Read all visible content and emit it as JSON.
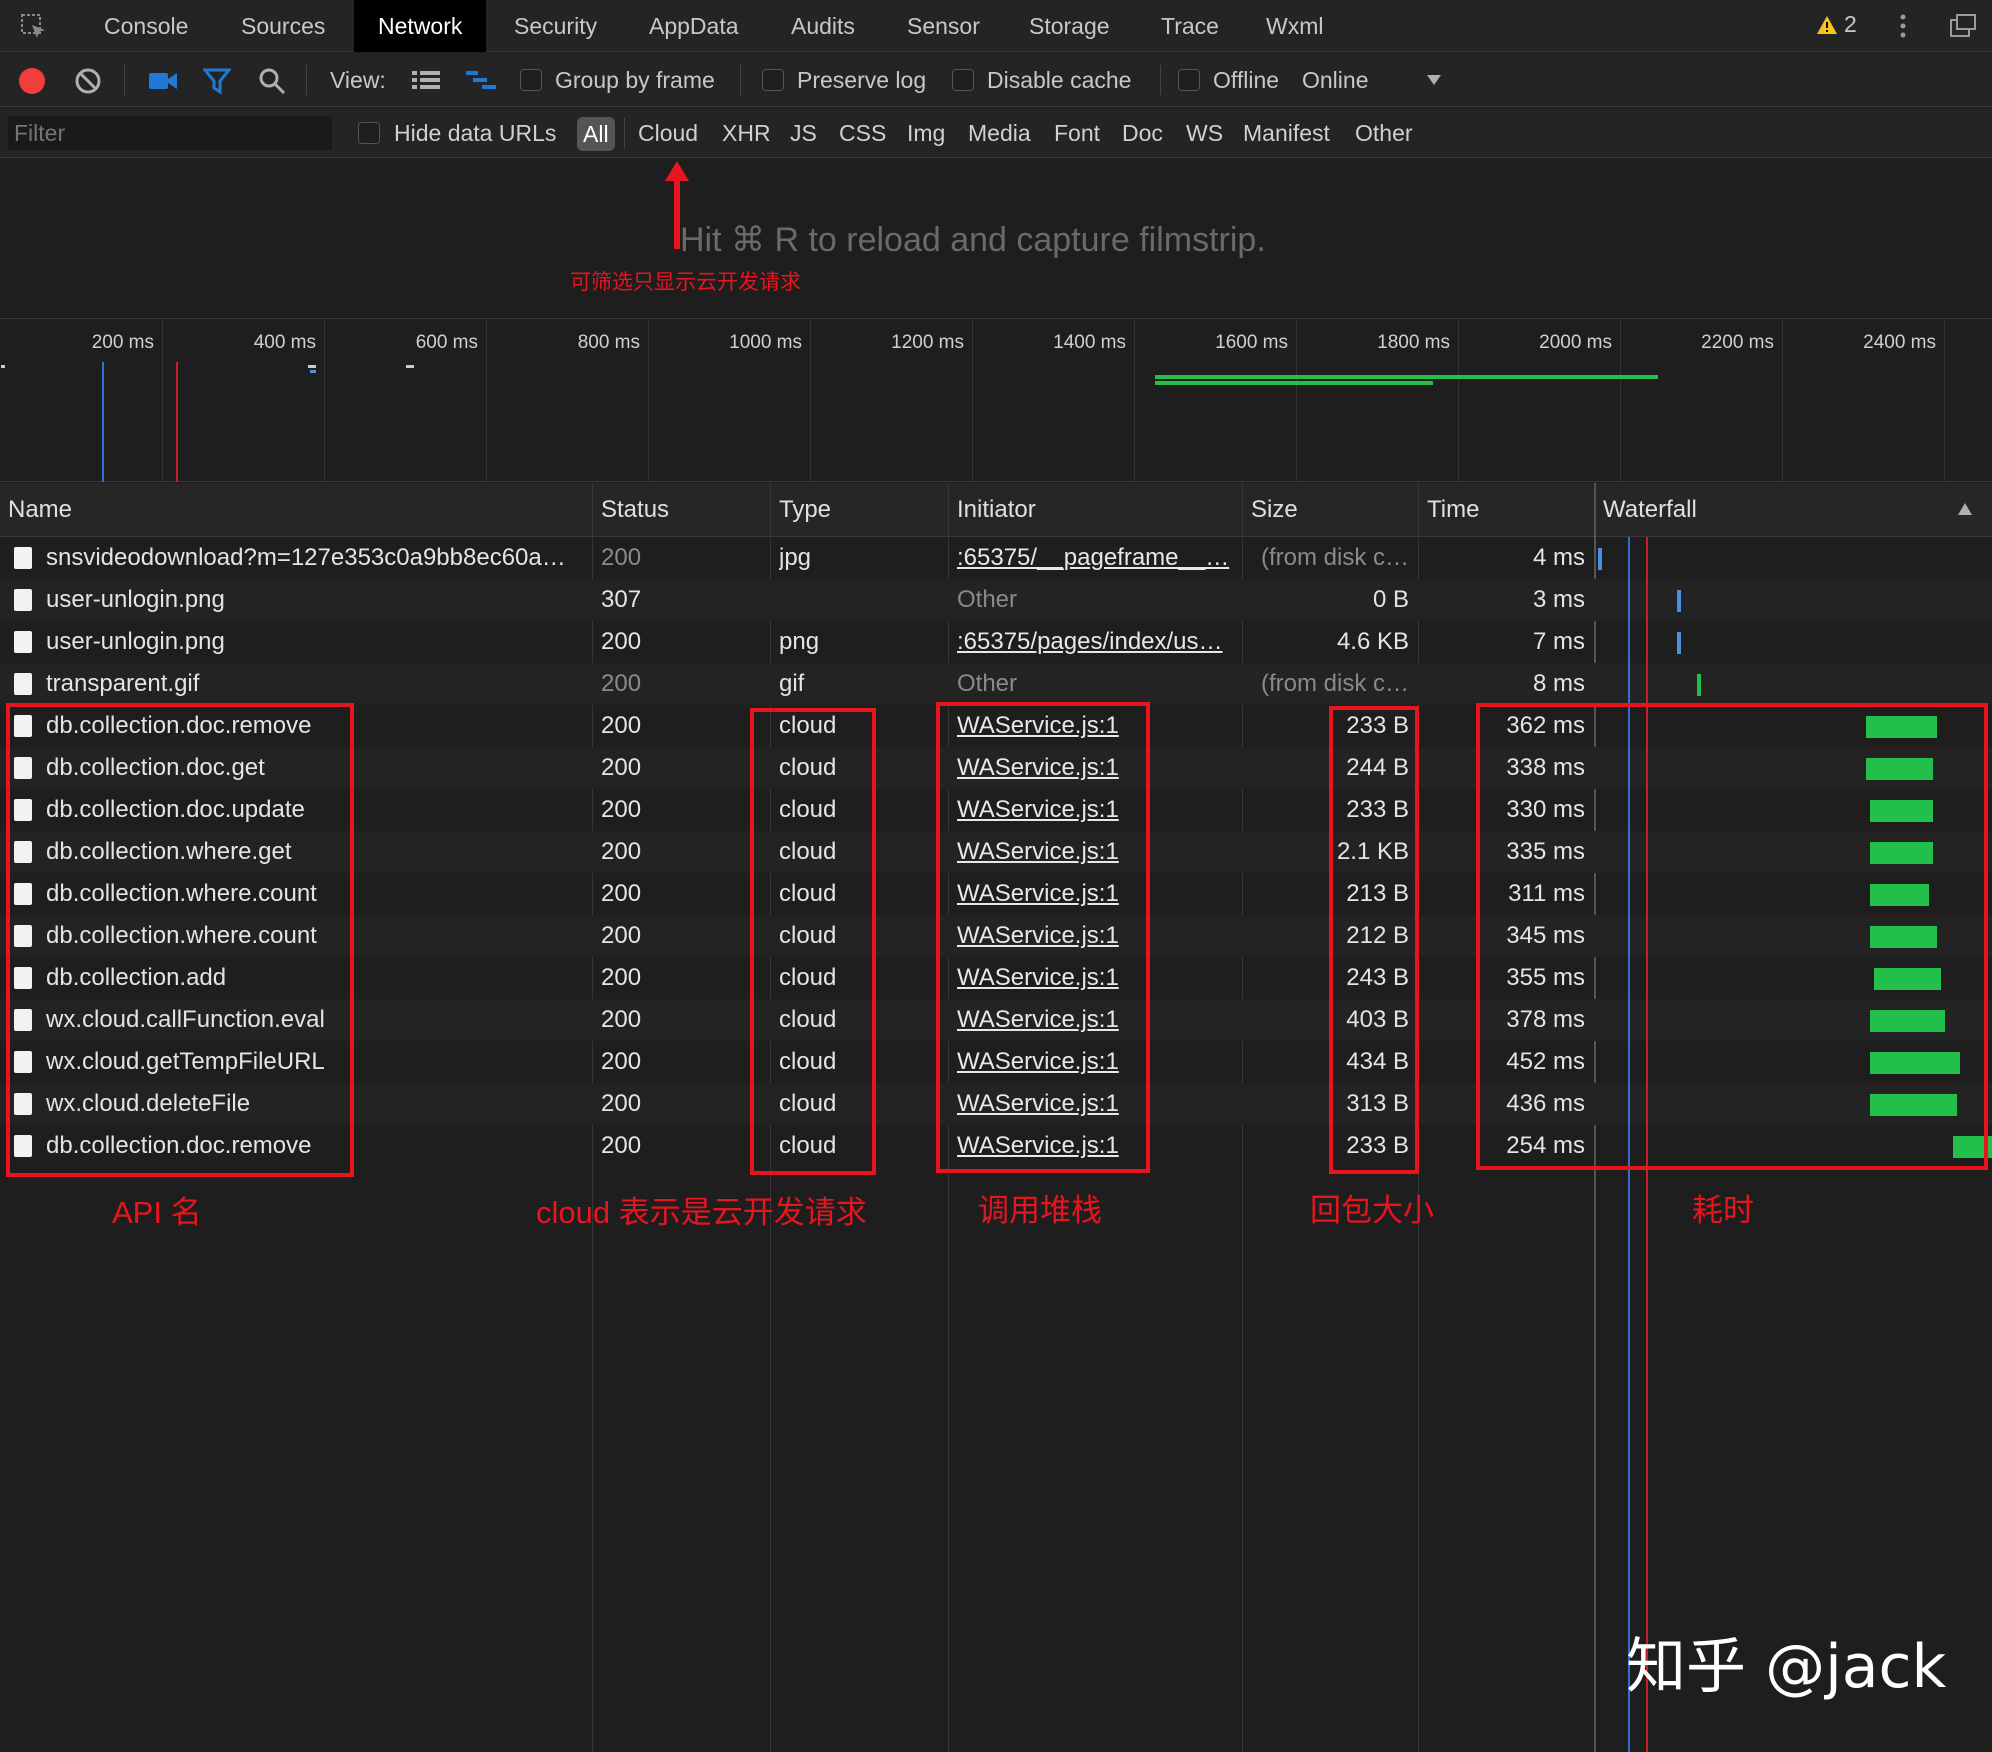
{
  "tabs": [
    {
      "label": "Console"
    },
    {
      "label": "Sources"
    },
    {
      "label": "Network"
    },
    {
      "label": "Security"
    },
    {
      "label": "AppData"
    },
    {
      "label": "Audits"
    },
    {
      "label": "Sensor"
    },
    {
      "label": "Storage"
    },
    {
      "label": "Trace"
    },
    {
      "label": "Wxml"
    }
  ],
  "warnings_count": "2",
  "toolbar": {
    "view_label": "View:",
    "group_by_frame": "Group by frame",
    "preserve_log": "Preserve log",
    "disable_cache": "Disable cache",
    "offline": "Offline",
    "throttle": "Online"
  },
  "filter": {
    "placeholder": "Filter",
    "hide_data_urls": "Hide data URLs",
    "types": [
      "All",
      "Cloud",
      "XHR",
      "JS",
      "CSS",
      "Img",
      "Media",
      "Font",
      "Doc",
      "WS",
      "Manifest",
      "Other"
    ]
  },
  "filmstrip_hint": "Hit ⌘ R to reload and capture filmstrip.",
  "annotations": {
    "cloud_filter": "可筛选只显示云开发请求",
    "api_name": "API 名",
    "cloud_type": "cloud 表示是云开发请求",
    "call_stack": "调用堆栈",
    "response_size": "回包大小",
    "time_cost": "耗时"
  },
  "overview_ticks": [
    "200 ms",
    "400 ms",
    "600 ms",
    "800 ms",
    "1000 ms",
    "1200 ms",
    "1400 ms",
    "1600 ms",
    "1800 ms",
    "2000 ms",
    "2200 ms",
    "2400 ms"
  ],
  "columns": [
    "Name",
    "Status",
    "Type",
    "Initiator",
    "Size",
    "Time",
    "Waterfall"
  ],
  "rows": [
    {
      "name": "snsvideodownload?m=127e353c0a9bb8ec60a…",
      "status": "200",
      "type": "jpg",
      "initiator": ":65375/__pageframe__…",
      "size": "(from disk c…",
      "time": "4 ms",
      "status_dim": true,
      "initiator_link": true,
      "size_dim": true,
      "wf_start": 0.0,
      "wf_len": 0.01,
      "wf_color": "#4a90e2"
    },
    {
      "name": "user-unlogin.png",
      "status": "307",
      "type": "",
      "initiator": "Other",
      "size": "0 B",
      "time": "3 ms",
      "status_dim": false,
      "initiator_link": false,
      "size_dim": false,
      "wf_start": 0.2,
      "wf_len": 0.01,
      "wf_color": "#4a90e2"
    },
    {
      "name": "user-unlogin.png",
      "status": "200",
      "type": "png",
      "initiator": ":65375/pages/index/us…",
      "size": "4.6 KB",
      "time": "7 ms",
      "status_dim": false,
      "initiator_link": true,
      "size_dim": false,
      "wf_start": 0.2,
      "wf_len": 0.01,
      "wf_color": "#4a90e2"
    },
    {
      "name": "transparent.gif",
      "status": "200",
      "type": "gif",
      "initiator": "Other",
      "size": "(from disk c…",
      "time": "8 ms",
      "status_dim": true,
      "initiator_link": false,
      "size_dim": true,
      "wf_start": 0.25,
      "wf_len": 0.01,
      "wf_color": "#22c04a"
    },
    {
      "name": "db.collection.doc.remove",
      "status": "200",
      "type": "cloud",
      "initiator": "WAService.js:1",
      "size": "233 B",
      "time": "362 ms",
      "status_dim": false,
      "initiator_link": true,
      "size_dim": false,
      "wf_start": 0.68,
      "wf_len": 0.18,
      "wf_color": "#22c04a"
    },
    {
      "name": "db.collection.doc.get",
      "status": "200",
      "type": "cloud",
      "initiator": "WAService.js:1",
      "size": "244 B",
      "time": "338 ms",
      "status_dim": false,
      "initiator_link": true,
      "size_dim": false,
      "wf_start": 0.68,
      "wf_len": 0.17,
      "wf_color": "#22c04a"
    },
    {
      "name": "db.collection.doc.update",
      "status": "200",
      "type": "cloud",
      "initiator": "WAService.js:1",
      "size": "233 B",
      "time": "330 ms",
      "status_dim": false,
      "initiator_link": true,
      "size_dim": false,
      "wf_start": 0.69,
      "wf_len": 0.16,
      "wf_color": "#22c04a"
    },
    {
      "name": "db.collection.where.get",
      "status": "200",
      "type": "cloud",
      "initiator": "WAService.js:1",
      "size": "2.1 KB",
      "time": "335 ms",
      "status_dim": false,
      "initiator_link": true,
      "size_dim": false,
      "wf_start": 0.69,
      "wf_len": 0.16,
      "wf_color": "#22c04a"
    },
    {
      "name": "db.collection.where.count",
      "status": "200",
      "type": "cloud",
      "initiator": "WAService.js:1",
      "size": "213 B",
      "time": "311 ms",
      "status_dim": false,
      "initiator_link": true,
      "size_dim": false,
      "wf_start": 0.69,
      "wf_len": 0.15,
      "wf_color": "#22c04a"
    },
    {
      "name": "db.collection.where.count",
      "status": "200",
      "type": "cloud",
      "initiator": "WAService.js:1",
      "size": "212 B",
      "time": "345 ms",
      "status_dim": false,
      "initiator_link": true,
      "size_dim": false,
      "wf_start": 0.69,
      "wf_len": 0.17,
      "wf_color": "#22c04a"
    },
    {
      "name": "db.collection.add",
      "status": "200",
      "type": "cloud",
      "initiator": "WAService.js:1",
      "size": "243 B",
      "time": "355 ms",
      "status_dim": false,
      "initiator_link": true,
      "size_dim": false,
      "wf_start": 0.7,
      "wf_len": 0.17,
      "wf_color": "#22c04a"
    },
    {
      "name": "wx.cloud.callFunction.eval",
      "status": "200",
      "type": "cloud",
      "initiator": "WAService.js:1",
      "size": "403 B",
      "time": "378 ms",
      "status_dim": false,
      "initiator_link": true,
      "size_dim": false,
      "wf_start": 0.69,
      "wf_len": 0.19,
      "wf_color": "#22c04a"
    },
    {
      "name": "wx.cloud.getTempFileURL",
      "status": "200",
      "type": "cloud",
      "initiator": "WAService.js:1",
      "size": "434 B",
      "time": "452 ms",
      "status_dim": false,
      "initiator_link": true,
      "size_dim": false,
      "wf_start": 0.69,
      "wf_len": 0.23,
      "wf_color": "#22c04a"
    },
    {
      "name": "wx.cloud.deleteFile",
      "status": "200",
      "type": "cloud",
      "initiator": "WAService.js:1",
      "size": "313 B",
      "time": "436 ms",
      "status_dim": false,
      "initiator_link": true,
      "size_dim": false,
      "wf_start": 0.69,
      "wf_len": 0.22,
      "wf_color": "#22c04a"
    },
    {
      "name": "db.collection.doc.remove",
      "status": "200",
      "type": "cloud",
      "initiator": "WAService.js:1",
      "size": "233 B",
      "time": "254 ms",
      "status_dim": false,
      "initiator_link": true,
      "size_dim": false,
      "wf_start": 0.9,
      "wf_len": 0.1,
      "wf_color": "#22c04a"
    }
  ],
  "watermark": "知乎 @jack",
  "colors": {
    "accent_red": "#e8141e",
    "record_red": "#f23d3d",
    "bar_green": "#22c04a",
    "bar_blue": "#4a90e2",
    "warning_yellow": "#f5c518"
  }
}
